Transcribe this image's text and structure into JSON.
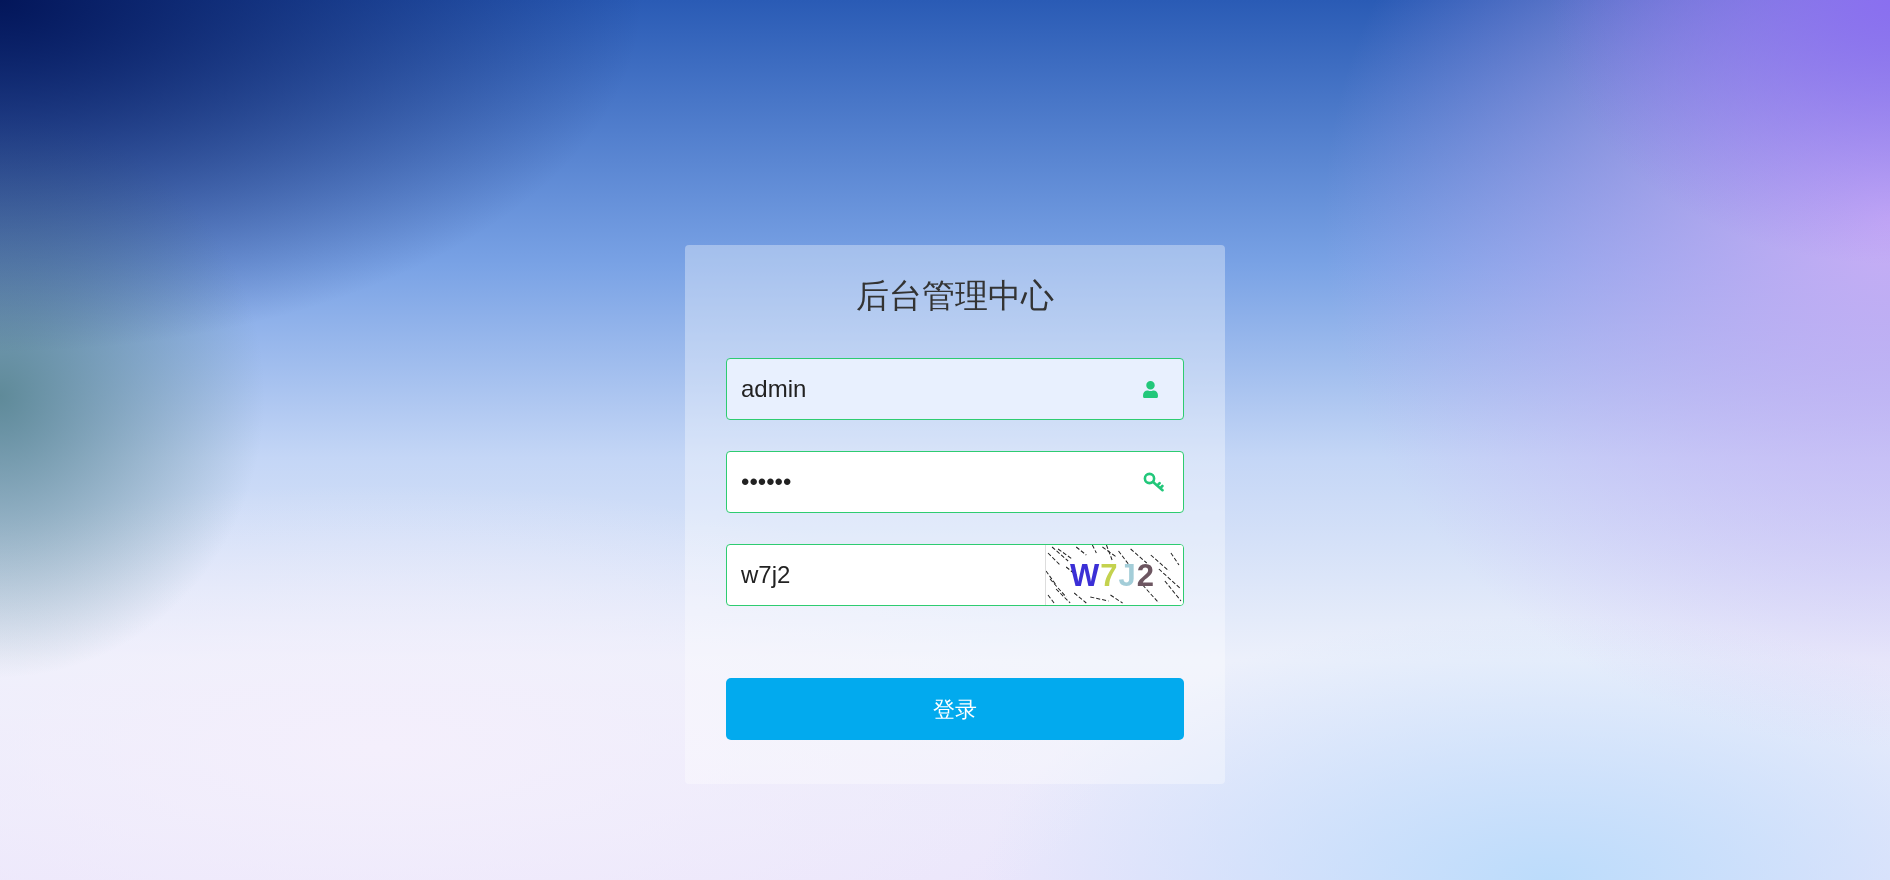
{
  "card": {
    "title": "后台管理中心"
  },
  "fields": [
    {
      "kind": "username",
      "value": "admin",
      "autofilled": true
    },
    {
      "kind": "password",
      "value": "••••••",
      "autofilled": false
    },
    {
      "kind": "captcha",
      "value": "w7j2",
      "autofilled": false,
      "captcha_text": "W7J2"
    }
  ],
  "login_button": {
    "label": "登录"
  }
}
